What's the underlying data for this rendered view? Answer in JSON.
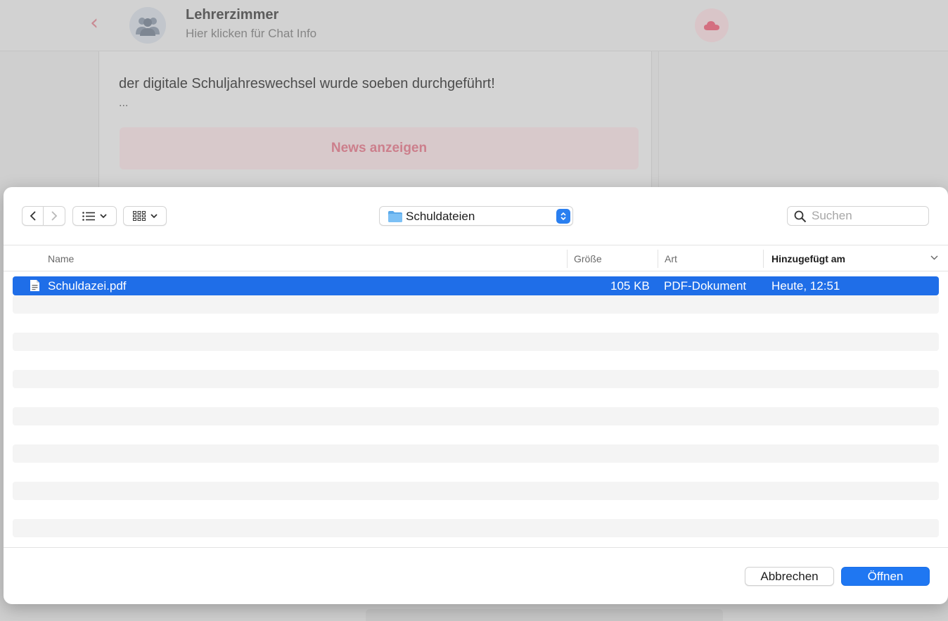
{
  "background": {
    "chat_title": "Lehrerzimmer",
    "chat_subtitle": "Hier klicken für Chat Info",
    "message_text": "der digitale Schuljahreswechsel wurde soeben durchgeführt!",
    "message_ellipsis": "...",
    "news_button": "News anzeigen"
  },
  "dialog": {
    "location": "Schuldateien",
    "search_placeholder": "Suchen",
    "columns": {
      "name": "Name",
      "size": "Größe",
      "kind": "Art",
      "date_added": "Hinzugefügt am"
    },
    "files": [
      {
        "name": "Schuldazei.pdf",
        "size": "105 KB",
        "kind": "PDF-Dokument",
        "date_added": "Heute, 12:51",
        "selected": true
      }
    ],
    "cancel_label": "Abbrechen",
    "open_label": "Öffnen"
  },
  "colors": {
    "accent": "#1f77f2",
    "selection": "#1f6ee8",
    "brand_pink": "#cc7f8c"
  }
}
